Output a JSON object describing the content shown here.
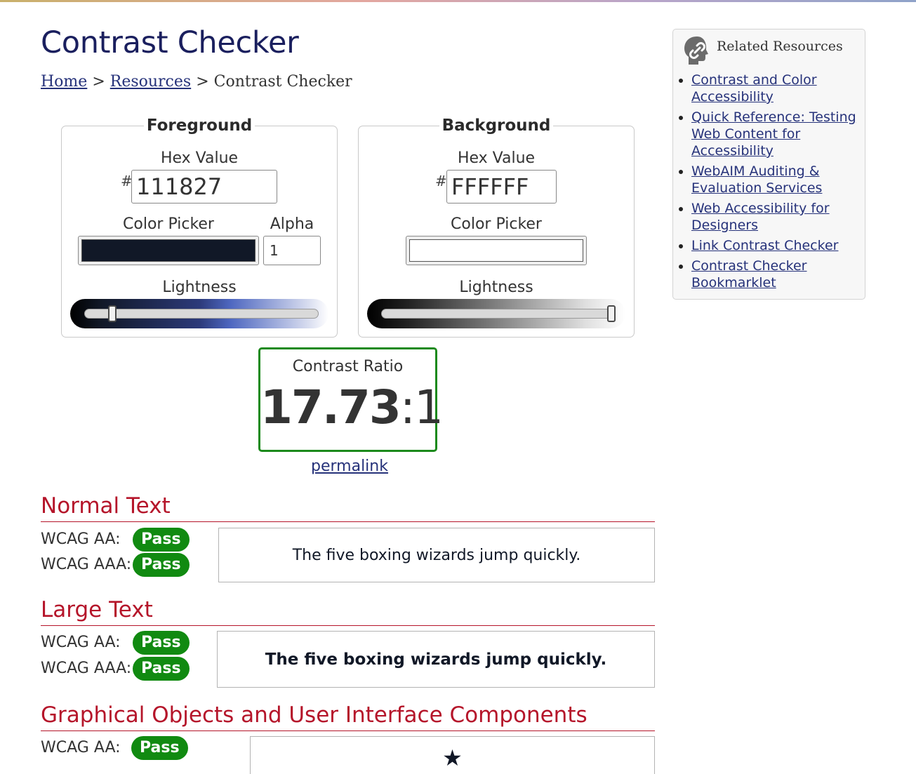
{
  "page": {
    "title": "Contrast Checker"
  },
  "breadcrumb": {
    "home": "Home",
    "resources": "Resources",
    "current": "Contrast Checker",
    "separator": ">"
  },
  "foreground": {
    "legend": "Foreground",
    "hex_label": "Hex Value",
    "hash": "#",
    "hex_value": "111827",
    "picker_label": "Color Picker",
    "alpha_label": "Alpha",
    "alpha_value": "1",
    "lightness_label": "Lightness",
    "lightness": 0.12,
    "color": "#111827"
  },
  "background": {
    "legend": "Background",
    "hex_label": "Hex Value",
    "hash": "#",
    "hex_value": "FFFFFF",
    "picker_label": "Color Picker",
    "lightness_label": "Lightness",
    "lightness": 1.0,
    "color": "#FFFFFF"
  },
  "contrast": {
    "label": "Contrast Ratio",
    "ratio": "17.73",
    "suffix": ":1",
    "permalink": "permalink"
  },
  "normal_text": {
    "title": "Normal Text",
    "aa_label": "WCAG AA:",
    "aa_result": "Pass",
    "aaa_label": "WCAG AAA:",
    "aaa_result": "Pass",
    "sample": "The five boxing wizards jump quickly."
  },
  "large_text": {
    "title": "Large Text",
    "aa_label": "WCAG AA:",
    "aa_result": "Pass",
    "aaa_label": "WCAG AAA:",
    "aaa_result": "Pass",
    "sample": "The five boxing wizards jump quickly."
  },
  "graphical": {
    "title": "Graphical Objects and User Interface Components",
    "aa_label": "WCAG AA:",
    "aa_result": "Pass",
    "sample_icon": "★"
  },
  "sidebar": {
    "title": "Related Resources",
    "icon": "link-head-icon",
    "items": [
      {
        "label": "Contrast and Color Accessibility"
      },
      {
        "label": "Quick Reference: Testing Web Content for Accessibility"
      },
      {
        "label": "WebAIM Auditing & Evaluation Services"
      },
      {
        "label": "Web Accessibility for Designers"
      },
      {
        "label": "Link Contrast Checker"
      },
      {
        "label": "Contrast Checker Bookmarklet"
      }
    ]
  },
  "colors": {
    "pass": "#118A11",
    "section_title": "#B5152A",
    "link": "#26327A",
    "ratio_border": "#1C8A1C"
  }
}
